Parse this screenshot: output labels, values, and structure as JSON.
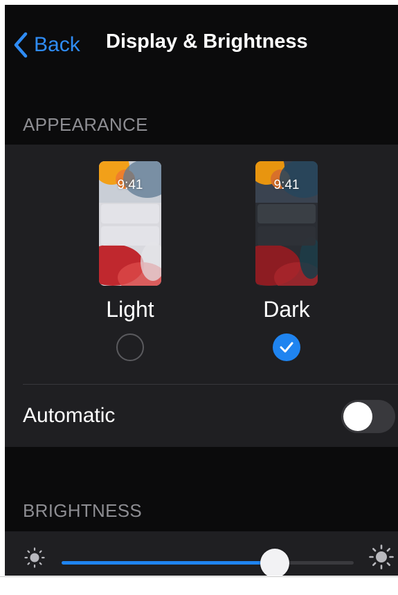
{
  "nav": {
    "back_label": "Back",
    "title": "Display & Brightness"
  },
  "appearance": {
    "header": "APPEARANCE",
    "options": [
      {
        "label": "Light",
        "time": "9:41",
        "selected": false
      },
      {
        "label": "Dark",
        "time": "9:41",
        "selected": true
      }
    ],
    "automatic": {
      "label": "Automatic",
      "enabled": false
    }
  },
  "brightness": {
    "header": "BRIGHTNESS",
    "level_fraction": 0.73
  },
  "icons": {
    "back": "chevron-left-icon",
    "checkmark": "checkmark-icon",
    "brightness_low": "sun-small-icon",
    "brightness_high": "sun-large-icon"
  },
  "colors": {
    "accent": "#1f84f0",
    "background": "#0b0b0c",
    "card": "#1f1f22",
    "secondary_text": "#8d8d92"
  }
}
